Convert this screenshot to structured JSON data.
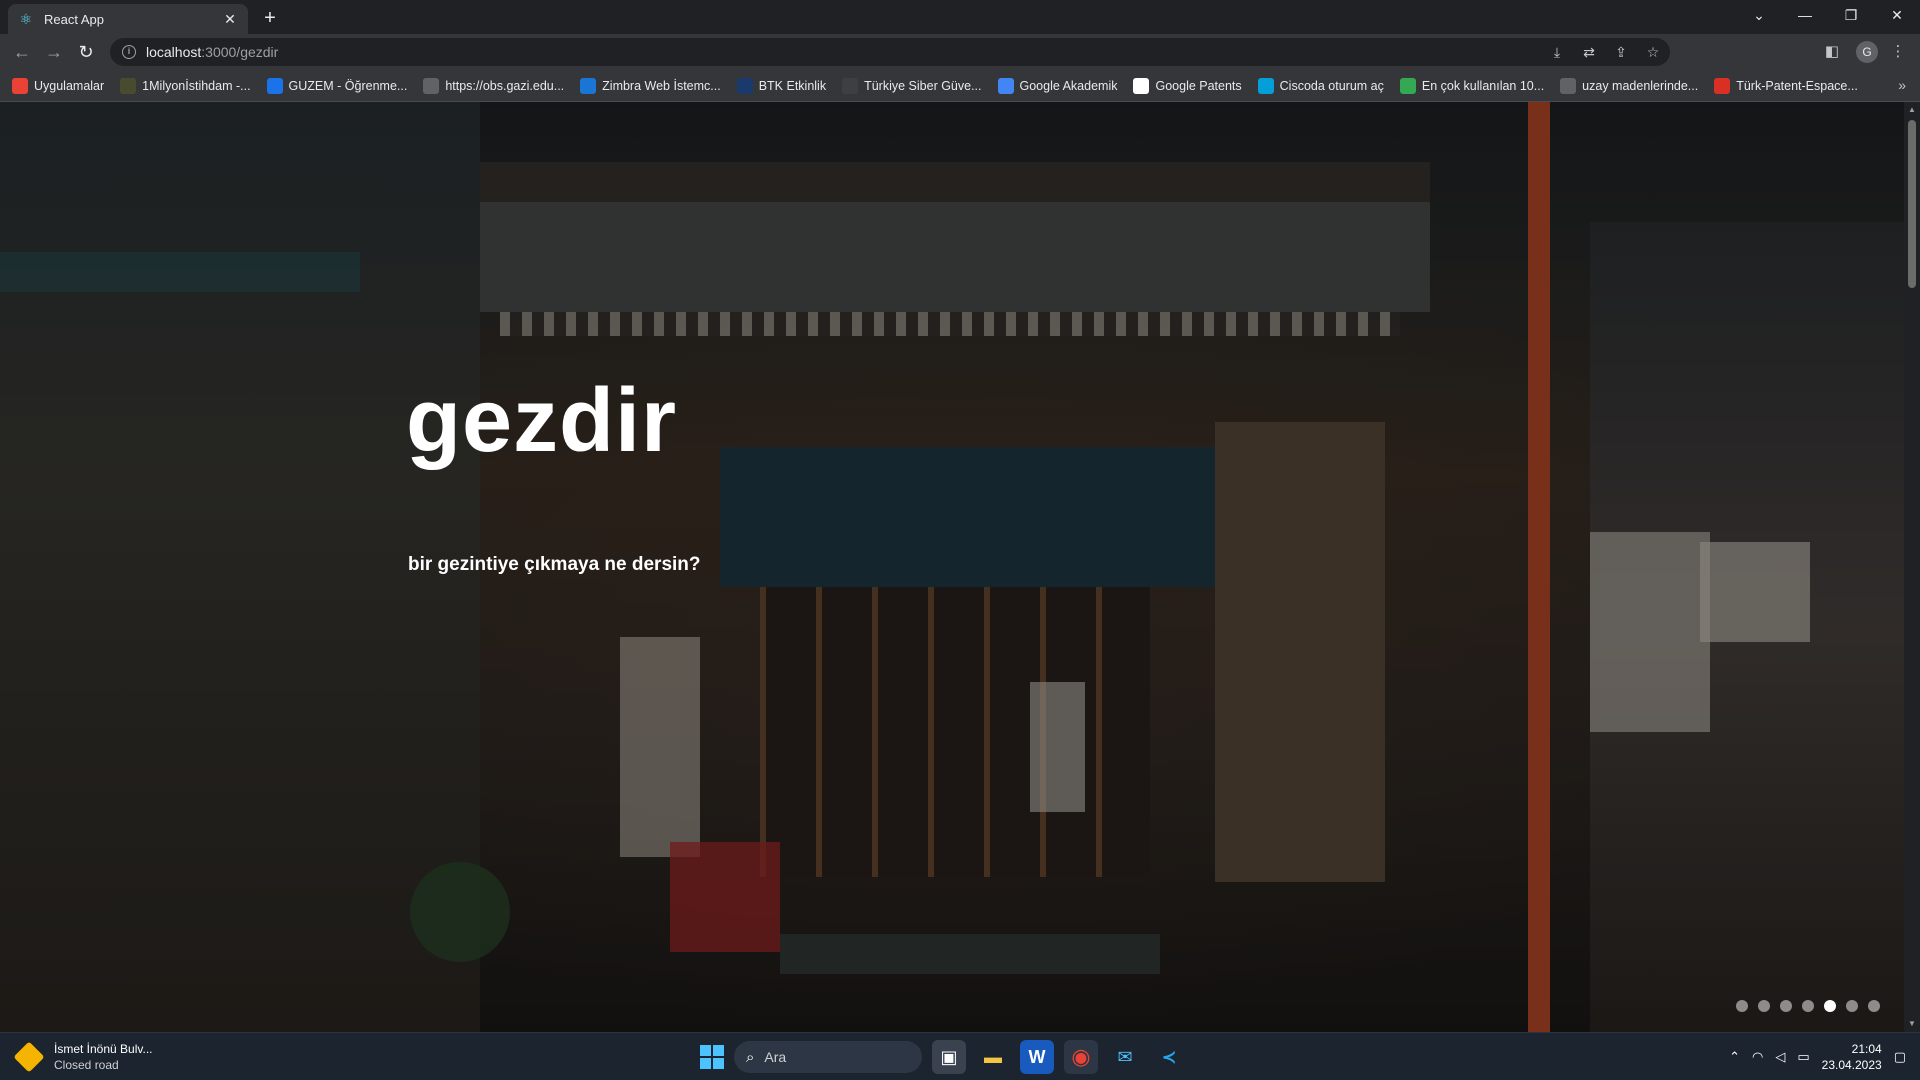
{
  "browser": {
    "tab_title": "React App",
    "url_host": "localhost",
    "url_path": ":3000/gezdir",
    "new_tab_symbol": "+",
    "icons": [
      "react-icon",
      "close-icon",
      "plus-icon",
      "back-icon",
      "forward-icon",
      "reload-icon",
      "info-icon",
      "download-icon",
      "translate-icon",
      "share-icon",
      "star-icon",
      "sidebar-icon",
      "menu-icon"
    ],
    "profile_initial": "G",
    "window_controls": [
      "⌄",
      "—",
      "❐",
      "✕"
    ]
  },
  "bookmarks": [
    {
      "label": "Uygulamalar",
      "icon": "apps-grid-icon",
      "color": "#ea4335"
    },
    {
      "label": "1Milyonİstihdam -...",
      "icon": "bookmark-icon",
      "color": "#4a4b2e"
    },
    {
      "label": "GUZEM - Öğrenme...",
      "icon": "guzem-icon",
      "color": "#1a73e8"
    },
    {
      "label": "https://obs.gazi.edu...",
      "icon": "globe-icon",
      "color": "#5f6368"
    },
    {
      "label": "Zimbra Web İstemc...",
      "icon": "zimbra-icon",
      "color": "#1976d2"
    },
    {
      "label": "BTK Etkinlik",
      "icon": "btk-icon",
      "color": "#1a3a6b"
    },
    {
      "label": "Türkiye Siber Güve...",
      "icon": "shield-icon",
      "color": "#3c4043"
    },
    {
      "label": "Google Akademik",
      "icon": "scholar-icon",
      "color": "#4285f4"
    },
    {
      "label": "Google Patents",
      "icon": "google-icon",
      "color": "#ffffff"
    },
    {
      "label": "Ciscoda oturum aç",
      "icon": "cisco-icon",
      "color": "#049fd9"
    },
    {
      "label": "En çok kullanılan 10...",
      "icon": "sheet-icon",
      "color": "#34a853"
    },
    {
      "label": "uzay madenlerinde...",
      "icon": "globe-icon",
      "color": "#5f6368"
    },
    {
      "label": "Türk-Patent-Espace...",
      "icon": "patent-icon",
      "color": "#d93025"
    }
  ],
  "hero": {
    "title": "gezdir",
    "subtitle": "bir gezintiye çıkmaya ne dersin?"
  },
  "carousel": {
    "slide_count": 7,
    "active_index": 4
  },
  "taskbar": {
    "weather_title": "İsmet İnönü Bulv...",
    "weather_sub": "Closed road",
    "search_placeholder": "Ara",
    "time": "21:04",
    "date": "23.04.2023",
    "apps": [
      "task-view-icon",
      "file-explorer-icon",
      "word-icon",
      "chrome-icon",
      "mail-icon",
      "vscode-icon"
    ]
  }
}
